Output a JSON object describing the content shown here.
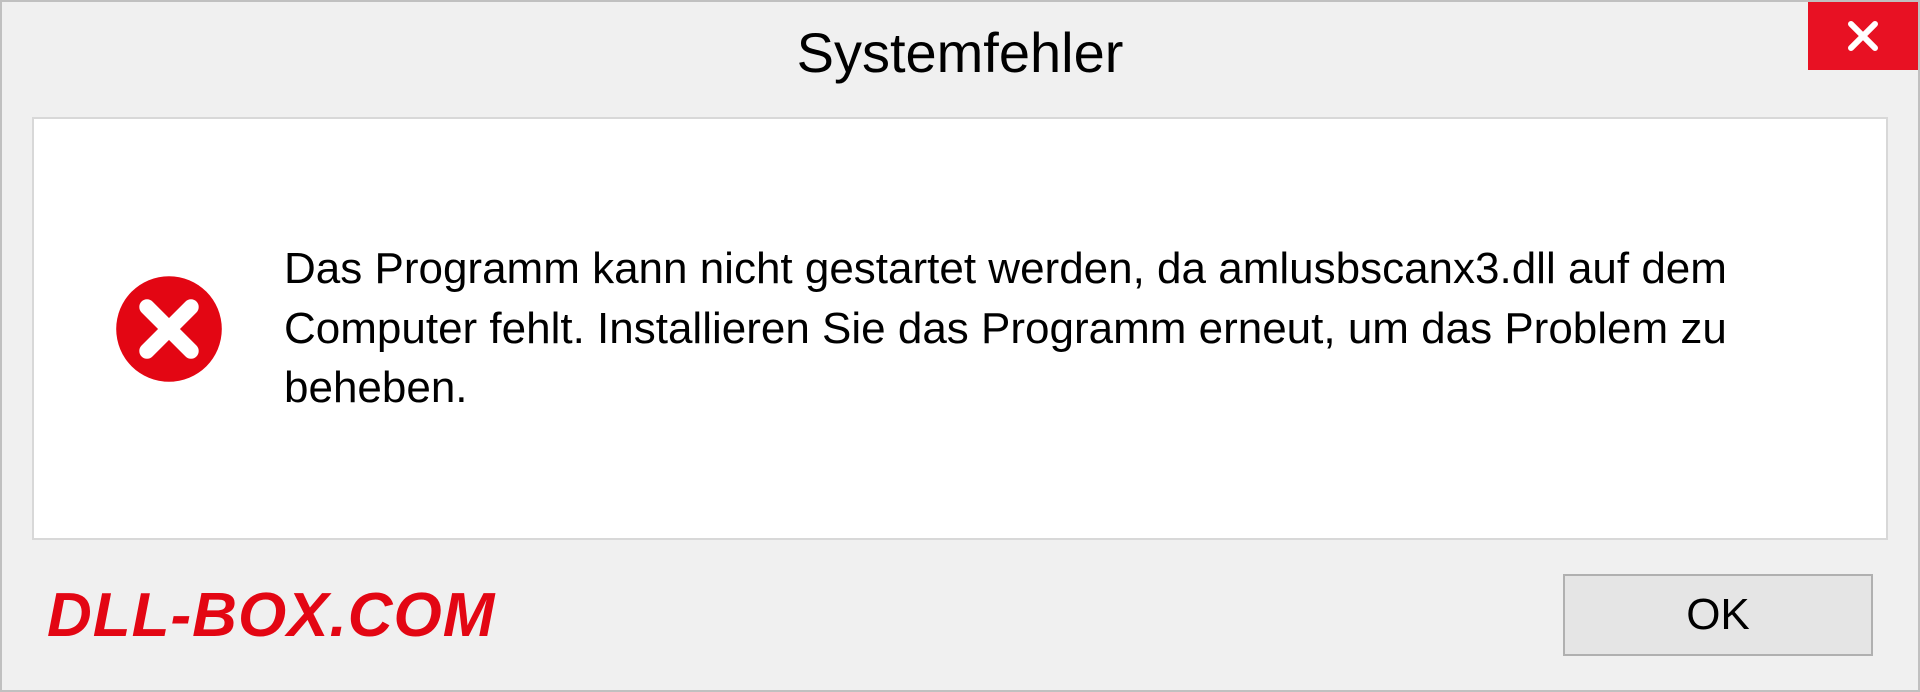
{
  "dialog": {
    "title": "Systemfehler",
    "message": "Das Programm kann nicht gestartet werden, da amlusbscanx3.dll auf dem Computer fehlt. Installieren Sie das Programm erneut, um das Problem zu beheben.",
    "ok_label": "OK"
  },
  "watermark": "DLL-BOX.COM"
}
